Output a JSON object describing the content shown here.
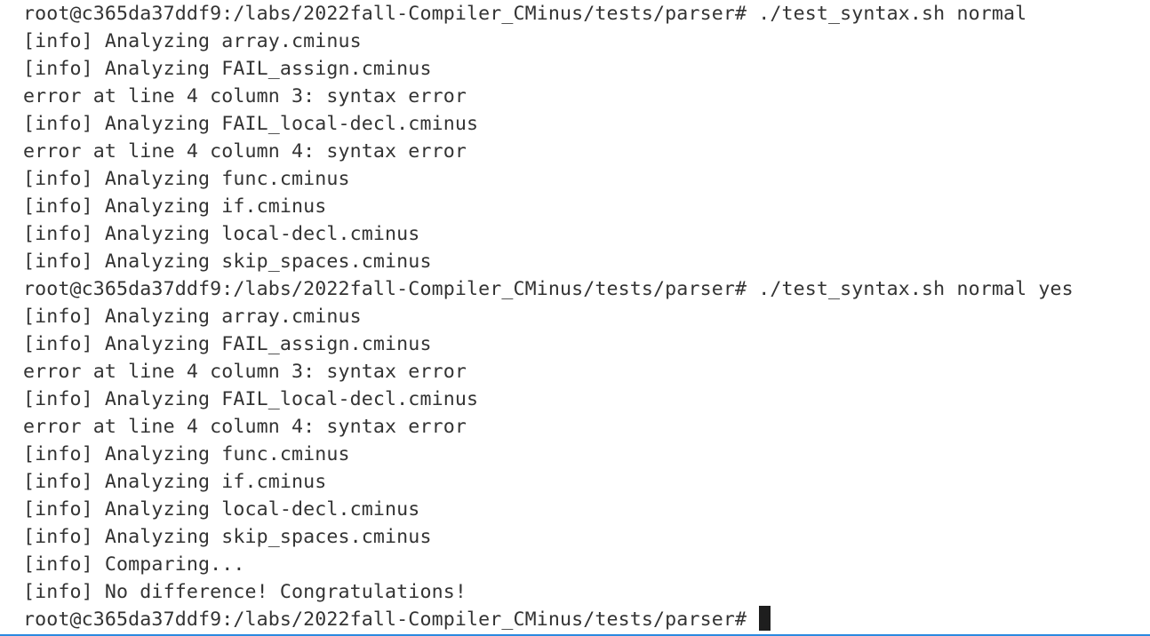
{
  "terminal": {
    "lines": [
      "root@c365da37ddf9:/labs/2022fall-Compiler_CMinus/tests/parser# ./test_syntax.sh normal",
      "[info] Analyzing array.cminus",
      "[info] Analyzing FAIL_assign.cminus",
      "error at line 4 column 3: syntax error",
      "[info] Analyzing FAIL_local-decl.cminus",
      "error at line 4 column 4: syntax error",
      "[info] Analyzing func.cminus",
      "[info] Analyzing if.cminus",
      "[info] Analyzing local-decl.cminus",
      "[info] Analyzing skip_spaces.cminus",
      "root@c365da37ddf9:/labs/2022fall-Compiler_CMinus/tests/parser# ./test_syntax.sh normal yes",
      "[info] Analyzing array.cminus",
      "[info] Analyzing FAIL_assign.cminus",
      "error at line 4 column 3: syntax error",
      "[info] Analyzing FAIL_local-decl.cminus",
      "error at line 4 column 4: syntax error",
      "[info] Analyzing func.cminus",
      "[info] Analyzing if.cminus",
      "[info] Analyzing local-decl.cminus",
      "[info] Analyzing skip_spaces.cminus",
      "[info] Comparing...",
      "[info] No difference! Congratulations!"
    ],
    "prompt": "root@c365da37ddf9:/labs/2022fall-Compiler_CMinus/tests/parser# "
  },
  "colors": {
    "background": "#ffffff",
    "text": "#333333",
    "cursor": "#1e1e1e",
    "focus_border": "#2b8ae0"
  }
}
